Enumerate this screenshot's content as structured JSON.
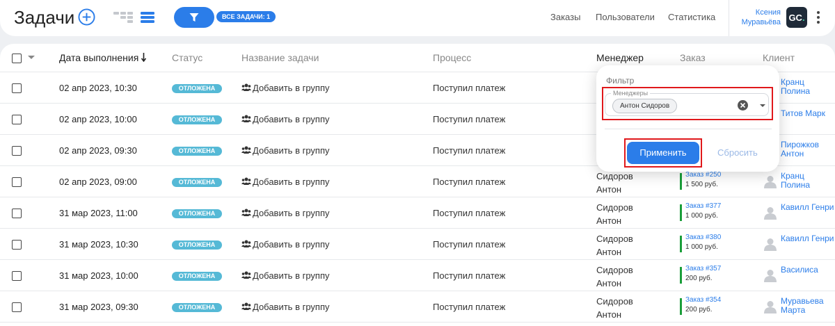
{
  "header": {
    "title": "Задачи",
    "filter_badge": "ВСЕ ЗАДАЧИ: 1",
    "nav": [
      "Заказы",
      "Пользователи",
      "Статистика"
    ],
    "user_name": "Ксения Муравьёва",
    "avatar_initials": "GC",
    "avatar_dot": ".",
    "accent_color": "#2b7de9"
  },
  "table": {
    "columns": {
      "date": "Дата выполнения",
      "status": "Статус",
      "name": "Название задачи",
      "process": "Процесс",
      "manager": "Менеджер",
      "order": "Заказ",
      "client": "Клиент"
    },
    "rows": [
      {
        "date": "02 апр 2023, 10:30",
        "status": "ОТЛОЖЕНА",
        "name": "Добавить в группу",
        "process": "Поступил платеж",
        "manager": "",
        "order": "",
        "sum": "",
        "client": "Кранц Полина"
      },
      {
        "date": "02 апр 2023, 10:00",
        "status": "ОТЛОЖЕНА",
        "name": "Добавить в группу",
        "process": "Поступил платеж",
        "manager": "",
        "order": "",
        "sum": "",
        "client": "Титов Марк"
      },
      {
        "date": "02 апр 2023, 09:30",
        "status": "ОТЛОЖЕНА",
        "name": "Добавить в группу",
        "process": "Поступил платеж",
        "manager": "",
        "order": "",
        "sum": "",
        "client": "Пирожков Антон"
      },
      {
        "date": "02 апр 2023, 09:00",
        "status": "ОТЛОЖЕНА",
        "name": "Добавить в группу",
        "process": "Поступил платеж",
        "manager": "Сидоров Антон",
        "order": "Заказ #250",
        "sum": "1 500 руб.",
        "client": "Кранц Полина"
      },
      {
        "date": "31 мар 2023, 11:00",
        "status": "ОТЛОЖЕНА",
        "name": "Добавить в группу",
        "process": "Поступил платеж",
        "manager": "Сидоров Антон",
        "order": "Заказ #377",
        "sum": "1 000 руб.",
        "client": "Кавилл Генри"
      },
      {
        "date": "31 мар 2023, 10:30",
        "status": "ОТЛОЖЕНА",
        "name": "Добавить в группу",
        "process": "Поступил платеж",
        "manager": "Сидоров Антон",
        "order": "Заказ #380",
        "sum": "1 000 руб.",
        "client": "Кавилл Генри"
      },
      {
        "date": "31 мар 2023, 10:00",
        "status": "ОТЛОЖЕНА",
        "name": "Добавить в группу",
        "process": "Поступил платеж",
        "manager": "Сидоров Антон",
        "order": "Заказ #357",
        "sum": "200 руб.",
        "client": "Василиса"
      },
      {
        "date": "31 мар 2023, 09:30",
        "status": "ОТЛОЖЕНА",
        "name": "Добавить в группу",
        "process": "Поступил платеж",
        "manager": "Сидоров Антон",
        "order": "Заказ #354",
        "sum": "200 руб.",
        "client": "Муравьева Марта"
      }
    ]
  },
  "filter": {
    "title": "Фильтр",
    "field_label": "Менеджеры",
    "selected": "Антон Сидоров",
    "apply": "Применить",
    "reset": "Сбросить"
  },
  "icons": {
    "add": "plus-circle-icon",
    "kanban": "kanban-view-icon",
    "list": "list-view-icon",
    "filter": "funnel-icon",
    "more": "more-vertical-icon",
    "group": "users-icon",
    "client": "user-avatar-icon",
    "clear": "clear-circle-icon"
  },
  "colors": {
    "status_deferred": "#55b9d6",
    "order_bar": "#1a9e3a",
    "highlight": "#e0181b"
  }
}
